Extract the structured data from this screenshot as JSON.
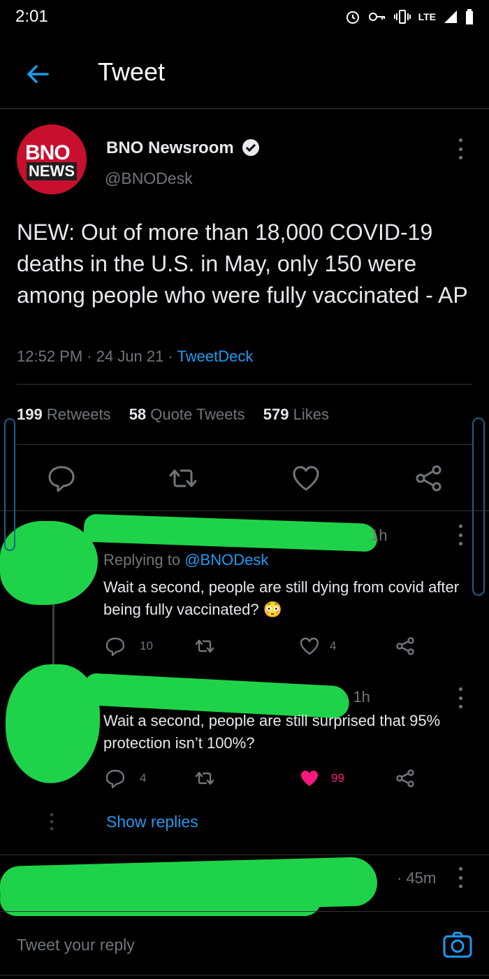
{
  "status_bar": {
    "time": "2:01",
    "network": "LTE"
  },
  "header": {
    "title": "Tweet"
  },
  "tweet": {
    "avatar_line1": "BNO",
    "avatar_line2": "NEWS",
    "author_name": "BNO Newsroom",
    "author_handle": "@BNODesk",
    "text": "NEW: Out of more than 18,000 COVID-19 deaths in the U.S. in May, only 150 were among people who were fully vaccinated - AP",
    "time": "12:52 PM",
    "date": "24 Jun 21",
    "source": "TweetDeck",
    "stats": {
      "retweets_count": "199",
      "retweets_label": "Retweets",
      "quotes_count": "58",
      "quotes_label": "Quote Tweets",
      "likes_count": "579",
      "likes_label": "Likes"
    }
  },
  "replies": [
    {
      "time": "1h",
      "replying_label": "Replying to",
      "replying_handle": "@BNODesk",
      "text": "Wait a second, people are still dying from covid after being fully vaccinated? 😳",
      "reply_count": "10",
      "like_count": "4",
      "liked": false
    },
    {
      "time": "· 1h",
      "text": "Wait a second, people are still surprised that 95% protection isn’t 100%?",
      "reply_count": "4",
      "like_count": "99",
      "liked": true,
      "show_replies_label": "Show replies"
    },
    {
      "time": "· 45m"
    }
  ],
  "composer": {
    "placeholder": "Tweet your reply"
  },
  "colors": {
    "accent": "#1d9bf0",
    "like": "#f91880",
    "redaction": "#1ed34a"
  }
}
